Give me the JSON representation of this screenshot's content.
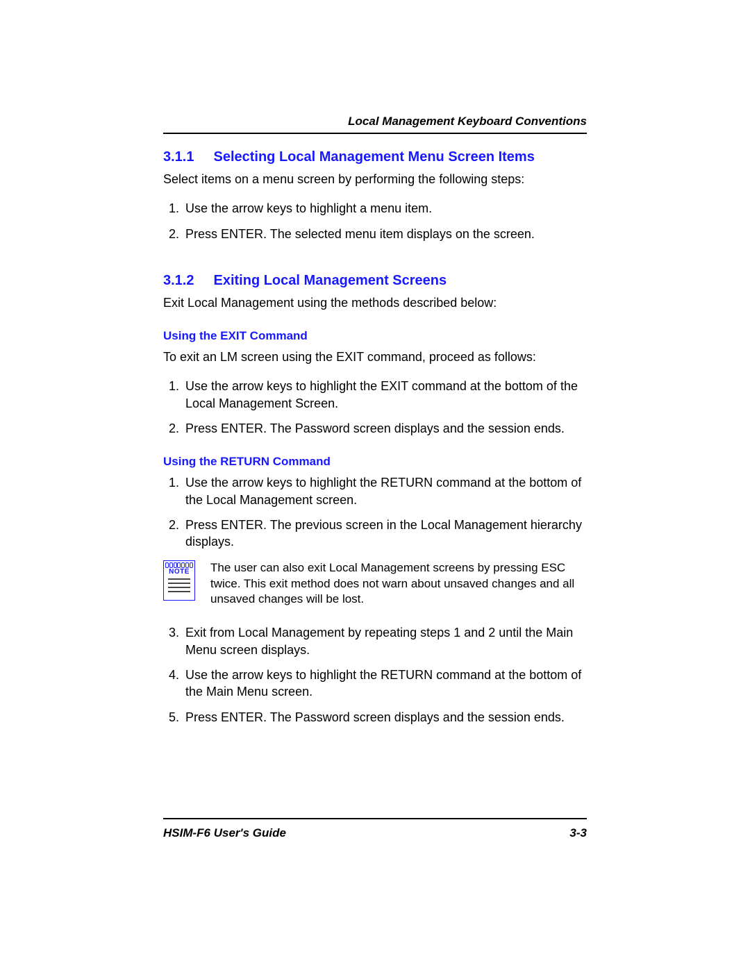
{
  "header": {
    "running": "Local Management Keyboard Conventions"
  },
  "sec311": {
    "number": "3.1.1",
    "title": "Selecting Local Management Menu Screen Items",
    "intro": "Select items on a menu screen by performing the following steps:",
    "steps": [
      "Use the arrow keys to highlight a menu item.",
      "Press ENTER. The selected menu item displays on the screen."
    ]
  },
  "sec312": {
    "number": "3.1.2",
    "title": "Exiting Local Management Screens",
    "intro": "Exit Local Management using the methods described below:",
    "exit": {
      "heading": "Using the EXIT Command",
      "intro": "To exit an LM screen using the EXIT command, proceed as follows:",
      "steps": [
        "Use the arrow keys to highlight the EXIT command at the bottom of the Local Management Screen.",
        "Press ENTER. The Password screen displays and the session ends."
      ]
    },
    "ret": {
      "heading": "Using the RETURN Command",
      "steps12": [
        "Use the arrow keys to highlight the RETURN command at the bottom of the Local Management screen.",
        "Press ENTER. The previous screen in the Local Management hierarchy displays."
      ],
      "note_label": "NOTE",
      "note": "The user can also exit Local Management screens by pressing ESC twice. This exit method does not warn about unsaved changes and all unsaved changes will be lost.",
      "steps345": [
        "Exit from Local Management by repeating steps 1 and 2 until the Main Menu screen displays.",
        "Use the arrow keys to highlight the RETURN command at the bottom of the Main Menu screen.",
        "Press ENTER. The Password screen displays and the session ends."
      ]
    }
  },
  "footer": {
    "guide": "HSIM-F6 User's Guide",
    "page": "3-3"
  }
}
